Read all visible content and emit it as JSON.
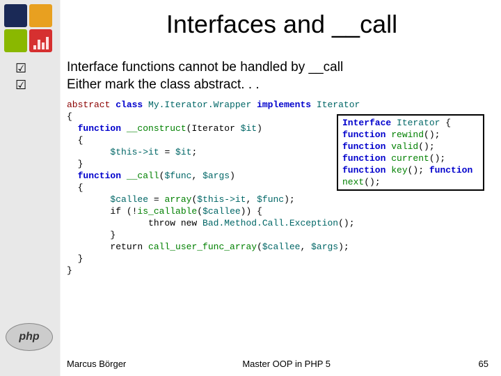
{
  "title": "Interfaces and __call",
  "bullets": [
    "Interface functions cannot be handled by __call",
    "Either mark the class abstract. . ."
  ],
  "code": {
    "l1a": "abstract",
    "l1b": " class ",
    "l1c": "My.Iterator.Wrapper",
    "l1d": " implements ",
    "l1e": "Iterator",
    "l2": "{",
    "l3a": "  function ",
    "l3b": "__construct",
    "l3c": "(Iterator ",
    "l3d": "$it",
    "l3e": ")",
    "l4": "  {",
    "l5a": "        $this->it ",
    "l5b": "= ",
    "l5c": "$it",
    "l5d": ";",
    "l6": "  }",
    "l7a": "  function ",
    "l7b": "__call",
    "l7c": "(",
    "l7d": "$func",
    "l7e": ", ",
    "l7f": "$args",
    "l7g": ")",
    "l8": "  {",
    "l9a": "        $callee ",
    "l9b": "= ",
    "l9c": "array",
    "l9d": "(",
    "l9e": "$this->it",
    "l9f": ", ",
    "l9g": "$func",
    "l9h": ");",
    "l10a": "        if (!",
    "l10b": "is_callable",
    "l10c": "(",
    "l10d": "$callee",
    "l10e": ")) {",
    "l11a": "               throw new ",
    "l11b": "Bad.Method.Call.Exception",
    "l11c": "();",
    "l12": "        }",
    "l13a": "        return ",
    "l13b": "call_user_func_array",
    "l13c": "(",
    "l13d": "$callee",
    "l13e": ", ",
    "l13f": "$args",
    "l13g": ");",
    "l14": "  }",
    "l15": "}"
  },
  "iface": {
    "l1a": "Interface ",
    "l1b": "Iterator",
    "l1c": " {",
    "l2a": "    function ",
    "l2b": "rewind",
    "l2c": "();",
    "l3a": "    function ",
    "l3b": "valid",
    "l3c": "();",
    "l4a": "    function ",
    "l4b": "current",
    "l4c": "();",
    "l5a": "    function ",
    "l5b": "key",
    "l5c": "();",
    "l6a": "    function ",
    "l6b": "next",
    "l6c": "();"
  },
  "php_label": "php",
  "footer": {
    "author": "Marcus Börger",
    "course": "Master OOP in PHP 5",
    "page": "65"
  }
}
